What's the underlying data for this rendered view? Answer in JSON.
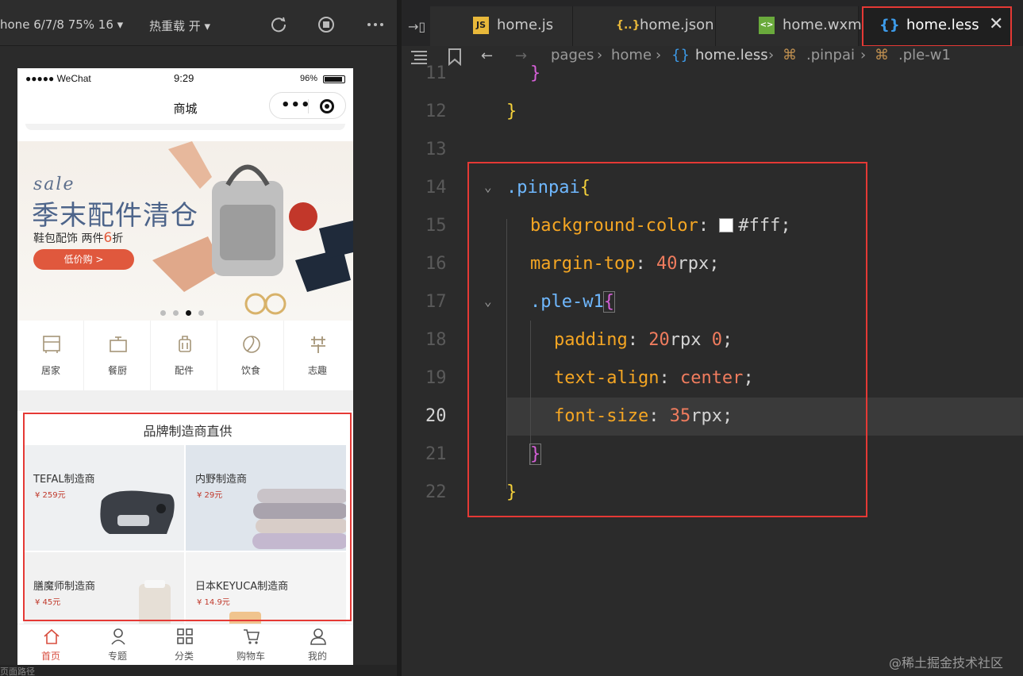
{
  "simulator": {
    "device_label": "hone 6/7/8 75% 16 ▾",
    "hotreload_label": "热重载 开 ▾",
    "status": {
      "carrier": "●●●●● WeChat",
      "time": "9:29",
      "battery": "96%"
    },
    "nav_title": "商城",
    "banner": {
      "sale": "sale",
      "headline": "季末配件清仓",
      "sub_prefix": "鞋包配饰 两件",
      "sub_num": "6",
      "sub_suffix": "折",
      "cta": "低价购 >"
    },
    "categories": [
      {
        "label": "居家"
      },
      {
        "label": "餐厨"
      },
      {
        "label": "配件"
      },
      {
        "label": "饮食"
      },
      {
        "label": "志趣"
      }
    ],
    "brand": {
      "title": "品牌制造商直供",
      "items": [
        {
          "name": "TEFAL制造商",
          "price": "¥ 259元"
        },
        {
          "name": "内野制造商",
          "price": "¥ 29元"
        },
        {
          "name": "膳魔师制造商",
          "price": "¥ 45元"
        },
        {
          "name": "日本KEYUCA制造商",
          "price": "¥ 14.9元"
        }
      ]
    },
    "tabbar": [
      {
        "label": "首页"
      },
      {
        "label": "专题"
      },
      {
        "label": "分类"
      },
      {
        "label": "购物车"
      },
      {
        "label": "我的"
      }
    ],
    "bottom_text": "页面路径"
  },
  "editor": {
    "tabs": [
      {
        "label": "home.js",
        "icon": "JS"
      },
      {
        "label": "home.json",
        "icon": "{..}"
      },
      {
        "label": "home.wxml",
        "icon": "<>"
      },
      {
        "label": "home.less",
        "icon": "{}"
      }
    ],
    "breadcrumb": [
      "pages",
      "home",
      "home.less",
      ".pinpai",
      ".ple-w1"
    ],
    "line_numbers": [
      "11",
      "12",
      "13",
      "14",
      "15",
      "16",
      "17",
      "18",
      "19",
      "20",
      "21",
      "22"
    ],
    "code": {
      "l11": "}",
      "l12": "}",
      "l14_sel": ".pinpai",
      "l14_brace": "{",
      "l15_prop": "background-color",
      "l15_val": "#fff;",
      "l16_prop": "margin-top",
      "l16_num": "40",
      "l16_unit": "rpx;",
      "l17_sel": ".ple-w1",
      "l17_brace": "{",
      "l18_prop": "padding",
      "l18_num": "20",
      "l18_unit": "rpx",
      "l18_num2": "0",
      "l18_end": ";",
      "l19_prop": "text-align",
      "l19_val": "center",
      "l19_end": ";",
      "l20_prop": "font-size",
      "l20_num": "35",
      "l20_unit": "rpx;",
      "l21": "}",
      "l22": "}",
      "colon": ":"
    }
  },
  "watermark": "@稀土掘金技术社区",
  "colors": {
    "highlight": "#e53935",
    "accent": "#d84e3f"
  }
}
